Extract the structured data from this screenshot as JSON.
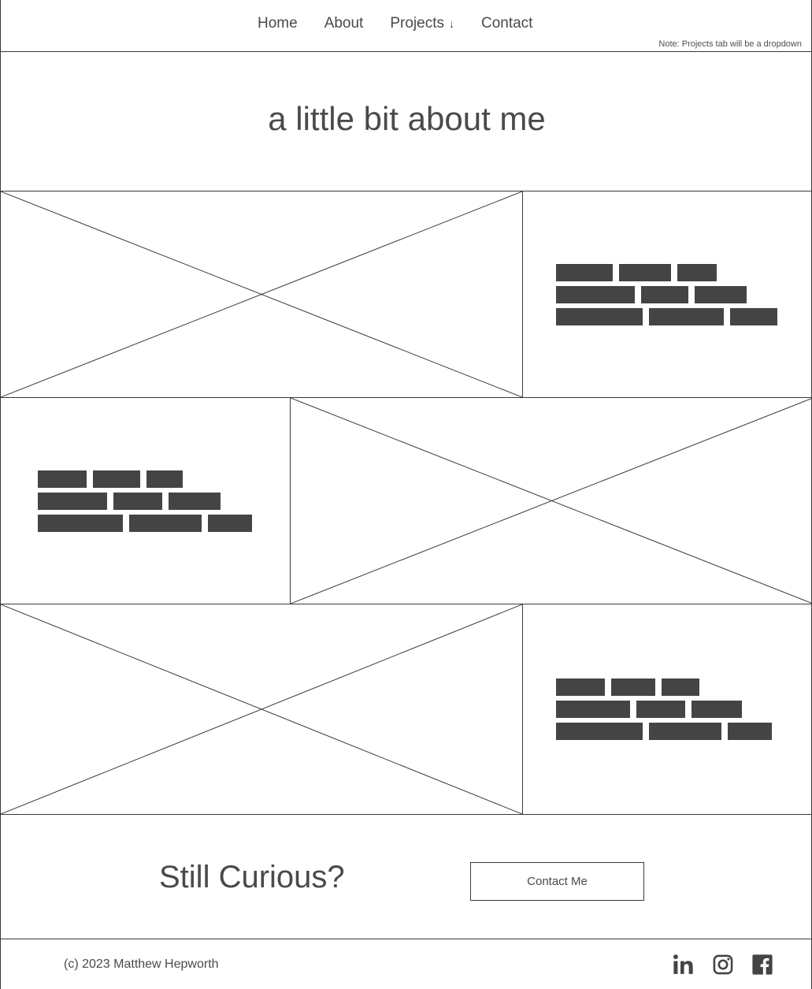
{
  "nav": {
    "items": [
      {
        "label": "Home",
        "has_caret": false,
        "caret": ""
      },
      {
        "label": "About",
        "has_caret": false,
        "caret": ""
      },
      {
        "label": "Projects",
        "has_caret": true,
        "caret": "↓"
      },
      {
        "label": "Contact",
        "has_caret": false,
        "caret": ""
      }
    ],
    "note": "Note: Projects tab will be a dropdown"
  },
  "hero": {
    "title": "a little bit about me"
  },
  "sections": [
    {
      "image_side": "left",
      "image_placeholder": "image-placeholder",
      "text_lines": [
        [
          72,
          66,
          50
        ],
        [
          100,
          60,
          66
        ],
        [
          110,
          95,
          60
        ]
      ]
    },
    {
      "image_side": "right",
      "image_placeholder": "image-placeholder",
      "text_lines": [
        [
          62,
          60,
          46
        ],
        [
          88,
          62,
          66
        ],
        [
          108,
          92,
          56
        ]
      ]
    },
    {
      "image_side": "left",
      "image_placeholder": "image-placeholder",
      "text_lines": [
        [
          62,
          56,
          48
        ],
        [
          94,
          62,
          64
        ],
        [
          110,
          92,
          56
        ]
      ]
    }
  ],
  "cta": {
    "title": "Still Curious?",
    "button_label": "Contact Me"
  },
  "footer": {
    "copyright": "(c) 2023 Matthew Hepworth",
    "socials": [
      {
        "name": "linkedin-icon",
        "label": "LinkedIn"
      },
      {
        "name": "instagram-icon",
        "label": "Instagram"
      },
      {
        "name": "facebook-icon",
        "label": "Facebook"
      }
    ]
  },
  "colors": {
    "border": "#3a3a3a",
    "text": "#4a4a4a",
    "placeholder_bar": "#444444",
    "background": "#ffffff"
  }
}
